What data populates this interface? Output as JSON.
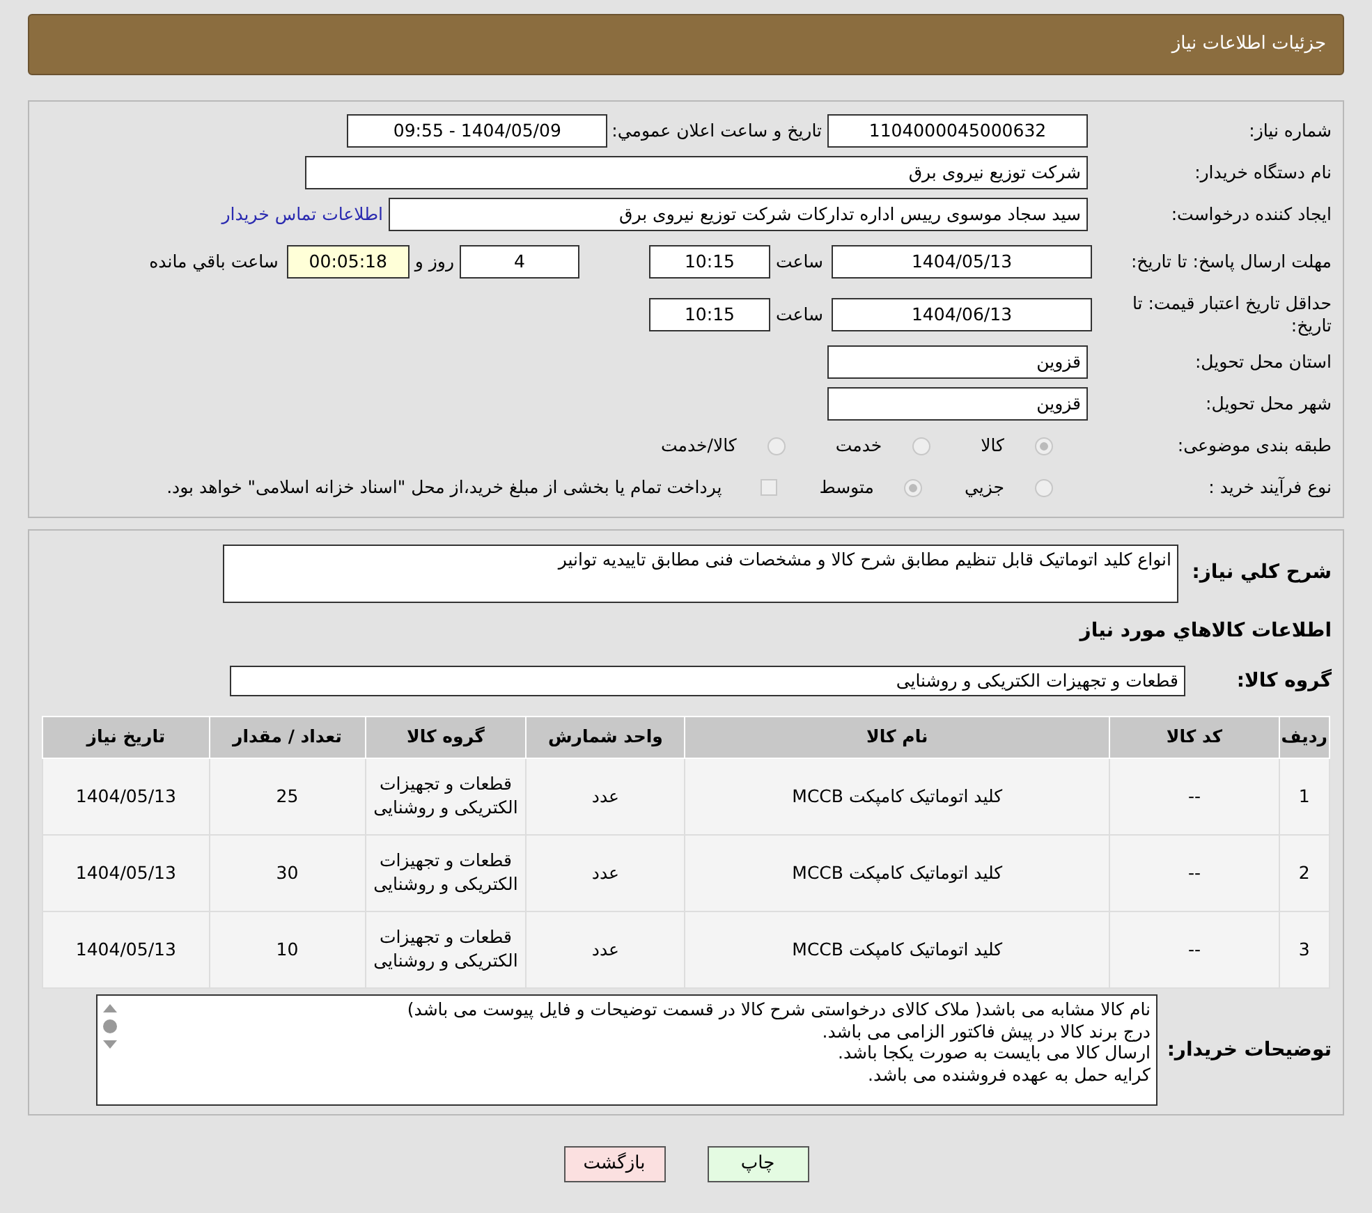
{
  "header": {
    "title": "جزئیات اطلاعات نیاز"
  },
  "details": [
    {
      "label": "شماره نیاز:",
      "items": [
        {
          "kind": "field",
          "value": "1104000045000632"
        },
        {
          "kind": "label",
          "text": "تاریخ و ساعت اعلان عمومي:"
        },
        {
          "kind": "field",
          "value": "1404/05/09 - 09:55"
        }
      ]
    },
    {
      "label": "نام دستگاه خریدار:",
      "items": [
        {
          "kind": "field",
          "value": "شرکت توزیع نیروی برق"
        }
      ]
    },
    {
      "label": "ایجاد کننده درخواست:",
      "items": [
        {
          "kind": "field",
          "value": "سید سجاد موسوی رییس اداره تدارکات شرکت توزیع نیروی برق"
        },
        {
          "kind": "link",
          "text": "اطلاعات تماس خریدار"
        }
      ]
    },
    {
      "label": "مهلت ارسال پاسخ: تا تاریخ:",
      "items": [
        {
          "kind": "field",
          "value": "1404/05/13"
        },
        {
          "kind": "label",
          "text": "ساعت"
        },
        {
          "kind": "field",
          "value": "10:15"
        },
        {
          "kind": "field",
          "value": "4"
        },
        {
          "kind": "label",
          "text": "روز و"
        },
        {
          "kind": "countdown",
          "value": "00:05:18"
        },
        {
          "kind": "label",
          "text": "ساعت باقي مانده"
        }
      ]
    },
    {
      "label": "حداقل تاریخ اعتبار قیمت: تا تاریخ:",
      "items": [
        {
          "kind": "field",
          "value": "1404/06/13"
        },
        {
          "kind": "label",
          "text": "ساعت"
        },
        {
          "kind": "field",
          "value": "10:15"
        }
      ]
    },
    {
      "label": "استان محل تحویل:",
      "items": [
        {
          "kind": "field",
          "value": "قزوین"
        }
      ]
    },
    {
      "label": "شهر محل تحویل:",
      "items": [
        {
          "kind": "field",
          "value": "قزوین"
        }
      ]
    },
    {
      "label": "طبقه بندی موضوعی:",
      "items": [
        {
          "kind": "radio",
          "text": "کالا",
          "selected": true
        },
        {
          "kind": "radio",
          "text": "خدمت",
          "selected": false
        },
        {
          "kind": "radio",
          "text": "کالا/خدمت",
          "selected": false
        }
      ]
    },
    {
      "label": "نوع فرآیند خرید :",
      "items": [
        {
          "kind": "radio",
          "text": "جزيي",
          "selected": false
        },
        {
          "kind": "radio",
          "text": "متوسط",
          "selected": true
        },
        {
          "kind": "checkbox",
          "checked": false
        },
        {
          "kind": "label",
          "text": "پرداخت تمام یا بخشی از مبلغ خرید،از محل \"اسناد خزانه اسلامی\" خواهد بود."
        }
      ]
    }
  ],
  "summary": {
    "label": "شرح کلي نیاز:",
    "value": "انواع کلید اتوماتیک قابل تنظیم  مطابق شرح کالا و مشخصات فنی مطابق تاییدیه توانیر"
  },
  "goods_heading": "اطلاعات کالاهاي مورد نیاز",
  "goods_group": {
    "label": "گروه کالا:",
    "value": "قطعات و تجهیزات الکتریکی و روشنایی"
  },
  "table": {
    "columns": [
      "ردیف",
      "کد کالا",
      "نام کالا",
      "واحد شمارش",
      "گروه کالا",
      "تعداد / مقدار",
      "تاریخ نیاز"
    ],
    "rows": [
      [
        "1",
        "--",
        "کلید اتوماتیک کامپکت MCCB",
        "عدد",
        "قطعات و تجهیزات الکتریکی و روشنایی",
        "25",
        "1404/05/13"
      ],
      [
        "2",
        "--",
        "کلید اتوماتیک کامپکت MCCB",
        "عدد",
        "قطعات و تجهیزات الکتریکی و روشنایی",
        "30",
        "1404/05/13"
      ],
      [
        "3",
        "--",
        "کلید اتوماتیک کامپکت MCCB",
        "عدد",
        "قطعات و تجهیزات الکتریکی و روشنایی",
        "10",
        "1404/05/13"
      ]
    ]
  },
  "buyer_notes": {
    "label": "توضیحات خریدار:",
    "value": "نام کالا مشابه می باشد( ملاک کالای درخواستی شرح کالا در قسمت توضیحات و فایل پیوست می باشد)\nدرج برند کالا در پیش فاکتور الزامی می باشد.\nارسال کالا می بایست به صورت یکجا باشد.\nکرایه حمل به عهده فروشنده می باشد."
  },
  "buttons": [
    {
      "kind": "print",
      "text": "چاپ"
    },
    {
      "kind": "back",
      "text": "بازگشت"
    }
  ]
}
